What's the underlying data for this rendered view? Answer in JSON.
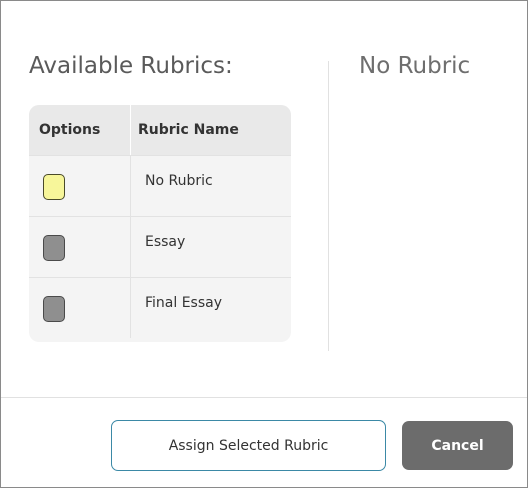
{
  "dialog": {
    "section_title": "Available Rubrics:",
    "preview_title": "No Rubric",
    "table": {
      "headers": [
        "Options",
        "Rubric Name"
      ],
      "rows": [
        {
          "name": "No Rubric",
          "color": "#f7f69a",
          "selected": true
        },
        {
          "name": "Essay",
          "color": "#8f8f8f",
          "selected": false
        },
        {
          "name": "Final Essay",
          "color": "#8f8f8f",
          "selected": false
        }
      ]
    },
    "buttons": {
      "assign_label": "Assign Selected Rubric",
      "cancel_label": "Cancel"
    },
    "colors": {
      "accent_border": "#3b89a6",
      "cancel_bg": "#6c6c6c"
    }
  }
}
